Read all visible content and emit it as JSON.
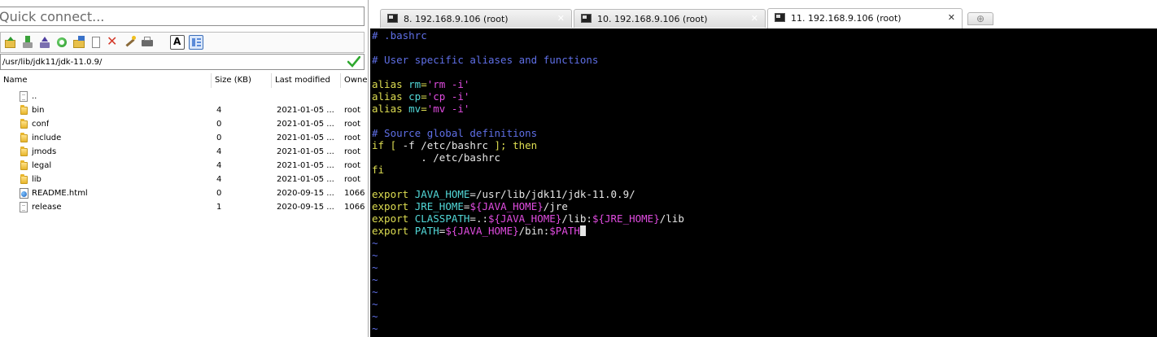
{
  "quick_connect": {
    "placeholder": "Quick connect..."
  },
  "toolbar": {
    "buttons": [
      "home-folder-icon",
      "download-icon",
      "upload-icon",
      "refresh-icon",
      "new-folder-icon",
      "new-file-icon",
      "delete-icon",
      "properties-wand-icon",
      "print-icon",
      "text-mode-icon",
      "view-toggle-icon"
    ]
  },
  "path": {
    "value": "/usr/lib/jdk11/jdk-11.0.9/"
  },
  "file_table": {
    "columns": [
      "Name",
      "Size (KB)",
      "Last modified",
      "Owner"
    ],
    "rows": [
      {
        "icon": "parent-file-icon",
        "name": "..",
        "size": "",
        "modified": "",
        "owner": ""
      },
      {
        "icon": "folder-icon",
        "name": "bin",
        "size": "4",
        "modified": "2021-01-05 ...",
        "owner": "root"
      },
      {
        "icon": "folder-icon",
        "name": "conf",
        "size": "0",
        "modified": "2021-01-05 ...",
        "owner": "root"
      },
      {
        "icon": "folder-icon",
        "name": "include",
        "size": "0",
        "modified": "2021-01-05 ...",
        "owner": "root"
      },
      {
        "icon": "folder-icon",
        "name": "jmods",
        "size": "4",
        "modified": "2021-01-05 ...",
        "owner": "root"
      },
      {
        "icon": "folder-icon",
        "name": "legal",
        "size": "4",
        "modified": "2021-01-05 ...",
        "owner": "root"
      },
      {
        "icon": "folder-icon",
        "name": "lib",
        "size": "4",
        "modified": "2021-01-05 ...",
        "owner": "root"
      },
      {
        "icon": "html-file-icon",
        "name": "README.html",
        "size": "0",
        "modified": "2020-09-15 ...",
        "owner": "1066"
      },
      {
        "icon": "file-icon",
        "name": "release",
        "size": "1",
        "modified": "2020-09-15 ...",
        "owner": "1066"
      }
    ]
  },
  "tabs": [
    {
      "label": "8. 192.168.9.106 (root)",
      "close": "✕",
      "active": false
    },
    {
      "label": "10. 192.168.9.106 (root)",
      "close": "✕",
      "active": false
    },
    {
      "label": "11. 192.168.9.106 (root)",
      "close": "✕",
      "active": true
    }
  ],
  "terminal": {
    "lines": [
      [
        [
          "cm",
          "# .bashrc"
        ]
      ],
      [],
      [
        [
          "cm",
          "# User specific aliases and functions"
        ]
      ],
      [],
      [
        [
          "ye",
          "alias "
        ],
        [
          "cy",
          "rm"
        ],
        [
          "ye",
          "="
        ],
        [
          "mg",
          "'rm -i'"
        ]
      ],
      [
        [
          "ye",
          "alias "
        ],
        [
          "cy",
          "cp"
        ],
        [
          "ye",
          "="
        ],
        [
          "mg",
          "'cp -i'"
        ]
      ],
      [
        [
          "ye",
          "alias "
        ],
        [
          "cy",
          "mv"
        ],
        [
          "ye",
          "="
        ],
        [
          "mg",
          "'mv -i'"
        ]
      ],
      [],
      [
        [
          "cm",
          "# Source global definitions"
        ]
      ],
      [
        [
          "ye",
          "if [ "
        ],
        [
          "ws",
          "-f /etc/bashrc "
        ],
        [
          "ye",
          "]; then"
        ]
      ],
      [
        [
          "ws",
          "        . /etc/bashrc"
        ]
      ],
      [
        [
          "ye",
          "fi"
        ]
      ],
      [],
      [
        [
          "ye",
          "export "
        ],
        [
          "cy",
          "JAVA_HOME"
        ],
        [
          "ws",
          "=/usr/lib/jdk11/jdk-11.0.9/"
        ]
      ],
      [
        [
          "ye",
          "export "
        ],
        [
          "cy",
          "JRE_HOME"
        ],
        [
          "ws",
          "="
        ],
        [
          "mg",
          "${JAVA_HOME}"
        ],
        [
          "ws",
          "/jre"
        ]
      ],
      [
        [
          "ye",
          "export "
        ],
        [
          "cy",
          "CLASSPATH"
        ],
        [
          "ws",
          "=.:"
        ],
        [
          "mg",
          "${JAVA_HOME}"
        ],
        [
          "ws",
          "/lib:"
        ],
        [
          "mg",
          "${JRE_HOME}"
        ],
        [
          "ws",
          "/lib"
        ]
      ],
      [
        [
          "ye",
          "export "
        ],
        [
          "cy",
          "PATH"
        ],
        [
          "ws",
          "="
        ],
        [
          "mg",
          "${JAVA_HOME}"
        ],
        [
          "ws",
          "/bin:"
        ],
        [
          "mg",
          "$PATH"
        ]
      ],
      [
        [
          "tilde",
          "~"
        ]
      ],
      [
        [
          "tilde",
          "~"
        ]
      ],
      [
        [
          "tilde",
          "~"
        ]
      ],
      [
        [
          "tilde",
          "~"
        ]
      ],
      [
        [
          "tilde",
          "~"
        ]
      ],
      [
        [
          "tilde",
          "~"
        ]
      ],
      [
        [
          "tilde",
          "~"
        ]
      ],
      [
        [
          "tilde",
          "~"
        ]
      ]
    ],
    "cursor_line": 16
  },
  "colors": {
    "comment": "#5f6fe6",
    "keyword": "#dede52",
    "variable": "#52d8d8",
    "string": "#e04ce0",
    "background": "#000000"
  }
}
